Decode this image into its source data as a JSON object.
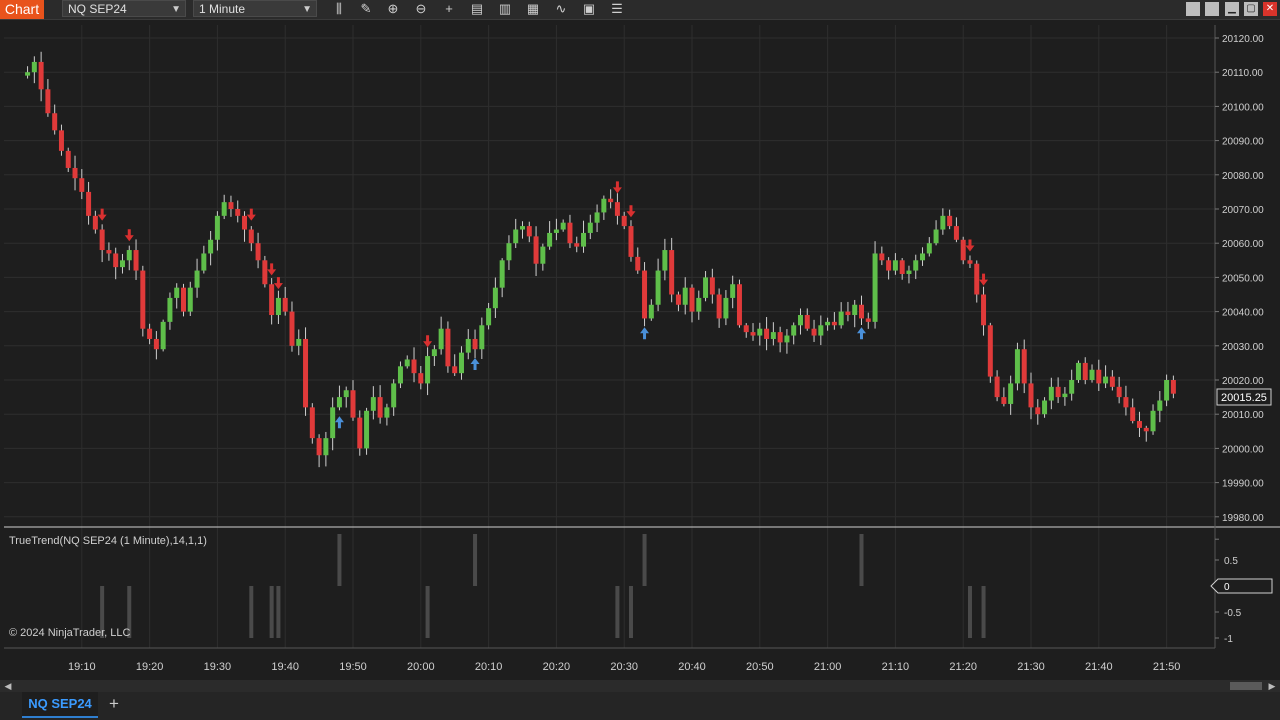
{
  "toolbar": {
    "chart_tab": "Chart",
    "instrument": "NQ SEP24",
    "interval": "1 Minute",
    "icons": [
      "bar-type-icon",
      "pencil-icon",
      "zoom-in-icon",
      "zoom-out-icon",
      "crosshair-icon",
      "data-box-icon",
      "properties-icon",
      "strategies-icon",
      "indicators-icon",
      "templates-icon",
      "more-icon"
    ]
  },
  "window_controls": [
    "minimize",
    "restore",
    "maximize",
    "close"
  ],
  "price_axis": {
    "labels": [
      "20120.00",
      "20110.00",
      "20100.00",
      "20090.00",
      "20080.00",
      "20070.00",
      "20060.00",
      "20050.00",
      "20040.00",
      "20030.00",
      "20020.00",
      "20010.00",
      "20000.00",
      "19990.00",
      "19980.00"
    ],
    "last_price": "20015.25"
  },
  "indicator_panel": {
    "title": "TrueTrend(NQ SEP24 (1 Minute),14,1,1)",
    "axis_labels": [
      "0.5",
      "0",
      "-0.5",
      "-1"
    ],
    "copyright": "© 2024 NinjaTrader, LLC"
  },
  "time_axis": [
    "19:10",
    "19:20",
    "19:30",
    "19:40",
    "19:50",
    "20:00",
    "20:10",
    "20:20",
    "20:30",
    "20:40",
    "20:50",
    "21:00",
    "21:10",
    "21:20",
    "21:30",
    "21:40",
    "21:50"
  ],
  "bottom_tabs": {
    "instrument_tab": "NQ SEP24",
    "add_tab": "+"
  },
  "colors": {
    "up": "#5fbf4a",
    "down": "#e03a3a",
    "buy_arrow": "#4a90d9",
    "sell_arrow": "#d93030",
    "accent": "#e8531c"
  },
  "chart_data": {
    "type": "candlestick",
    "instrument": "NQ SEP24",
    "interval": "1 Minute",
    "ylim": [
      19978,
      20124
    ],
    "close_series": [
      20110,
      20113,
      20105,
      20098,
      20093,
      20087,
      20082,
      20079,
      20075,
      20068,
      20064,
      20058,
      20057,
      20053,
      20055,
      20058,
      20052,
      20035,
      20032,
      20029,
      20037,
      20044,
      20047,
      20040,
      20047,
      20052,
      20057,
      20061,
      20068,
      20072,
      20070,
      20068,
      20064,
      20060,
      20055,
      20048,
      20039,
      20044,
      20040,
      20030,
      20032,
      20012,
      20003,
      19998,
      20003,
      20012,
      20015,
      20017,
      20009,
      20000,
      20011,
      20015,
      20009,
      20012,
      20019,
      20024,
      20026,
      20022,
      20019,
      20027,
      20029,
      20035,
      20024,
      20022,
      20028,
      20032,
      20029,
      20036,
      20041,
      20047,
      20055,
      20060,
      20064,
      20065,
      20062,
      20054,
      20059,
      20063,
      20064,
      20066,
      20060,
      20059,
      20063,
      20066,
      20069,
      20073,
      20072,
      20068,
      20065,
      20056,
      20052,
      20038,
      20042,
      20052,
      20058,
      20045,
      20042,
      20047,
      20040,
      20044,
      20050,
      20045,
      20038,
      20044,
      20048,
      20036,
      20034,
      20033,
      20035,
      20032,
      20034,
      20031,
      20033,
      20036,
      20039,
      20035,
      20033,
      20036,
      20037,
      20036,
      20040,
      20039,
      20042,
      20038,
      20037,
      20057,
      20055,
      20052,
      20055,
      20051,
      20052,
      20055,
      20057,
      20060,
      20064,
      20068,
      20065,
      20061,
      20055,
      20054,
      20045,
      20036,
      20021,
      20015,
      20013,
      20019,
      20029,
      20019,
      20012,
      20010,
      20014,
      20018,
      20015,
      20016,
      20020,
      20025,
      20020,
      20023,
      20019,
      20021,
      20018,
      20015,
      20012,
      20008,
      20006,
      20005,
      20011,
      20014,
      20020,
      20016
    ],
    "buy_signal_times": [
      "19:48",
      "20:08",
      "20:33",
      "21:05"
    ],
    "sell_signal_times": [
      "19:13",
      "19:17",
      "19:35",
      "19:38",
      "19:39",
      "20:01",
      "20:29",
      "20:31",
      "21:21",
      "21:23"
    ],
    "indicator": {
      "name": "TrueTrend",
      "params": "14,1,1",
      "signals": [
        {
          "time": "19:13",
          "value": -1
        },
        {
          "time": "19:17",
          "value": -1
        },
        {
          "time": "19:35",
          "value": -1
        },
        {
          "time": "19:38",
          "value": -1
        },
        {
          "time": "19:39",
          "value": -1
        },
        {
          "time": "19:48",
          "value": 1
        },
        {
          "time": "20:01",
          "value": -1
        },
        {
          "time": "20:08",
          "value": 1
        },
        {
          "time": "20:29",
          "value": -1
        },
        {
          "time": "20:31",
          "value": -1
        },
        {
          "time": "20:33",
          "value": 1
        },
        {
          "time": "21:05",
          "value": 1
        },
        {
          "time": "21:21",
          "value": -1
        },
        {
          "time": "21:23",
          "value": -1
        }
      ]
    }
  }
}
